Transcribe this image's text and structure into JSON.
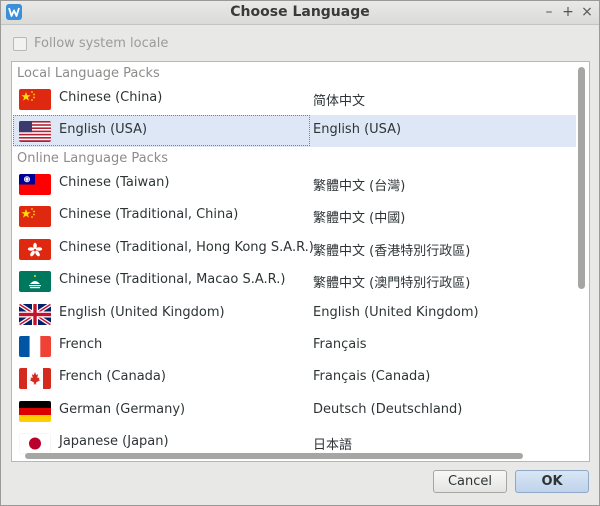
{
  "window": {
    "title": "Choose Language",
    "icon": "wps-icon",
    "controls": {
      "minimize": "–",
      "maximize": "+",
      "close": "×"
    }
  },
  "follow_system_locale": {
    "label": "Follow system locale",
    "checked": false
  },
  "sections": {
    "local": "Local Language Packs",
    "online": "Online Language Packs"
  },
  "local_languages": [
    {
      "name": "Chinese (China)",
      "native": "简体中文",
      "flag": "flag-cn-icon"
    },
    {
      "name": "English (USA)",
      "native": "English (USA)",
      "flag": "flag-us-icon",
      "selected": true
    }
  ],
  "online_languages": [
    {
      "name": "Chinese (Taiwan)",
      "native": "繁體中文 (台灣)",
      "flag": "flag-tw-icon"
    },
    {
      "name": "Chinese (Traditional, China)",
      "native": "繁體中文 (中國)",
      "flag": "flag-cn-icon"
    },
    {
      "name": "Chinese (Traditional, Hong Kong S.A.R.)",
      "native": "繁體中文 (香港特別行政區)",
      "flag": "flag-hk-icon"
    },
    {
      "name": "Chinese (Traditional, Macao S.A.R.)",
      "native": "繁體中文 (澳門特別行政區)",
      "flag": "flag-mo-icon"
    },
    {
      "name": "English (United Kingdom)",
      "native": "English (United Kingdom)",
      "flag": "flag-gb-icon"
    },
    {
      "name": "French",
      "native": "Français",
      "flag": "flag-fr-icon"
    },
    {
      "name": "French (Canada)",
      "native": "Français (Canada)",
      "flag": "flag-ca-icon"
    },
    {
      "name": "German (Germany)",
      "native": "Deutsch (Deutschland)",
      "flag": "flag-de-icon"
    },
    {
      "name": "Japanese (Japan)",
      "native": "日本語",
      "flag": "flag-jp-icon"
    }
  ],
  "buttons": {
    "cancel": "Cancel",
    "ok": "OK"
  },
  "colors": {
    "selection": "#dde7f6",
    "accent": "#3b8fd9"
  }
}
